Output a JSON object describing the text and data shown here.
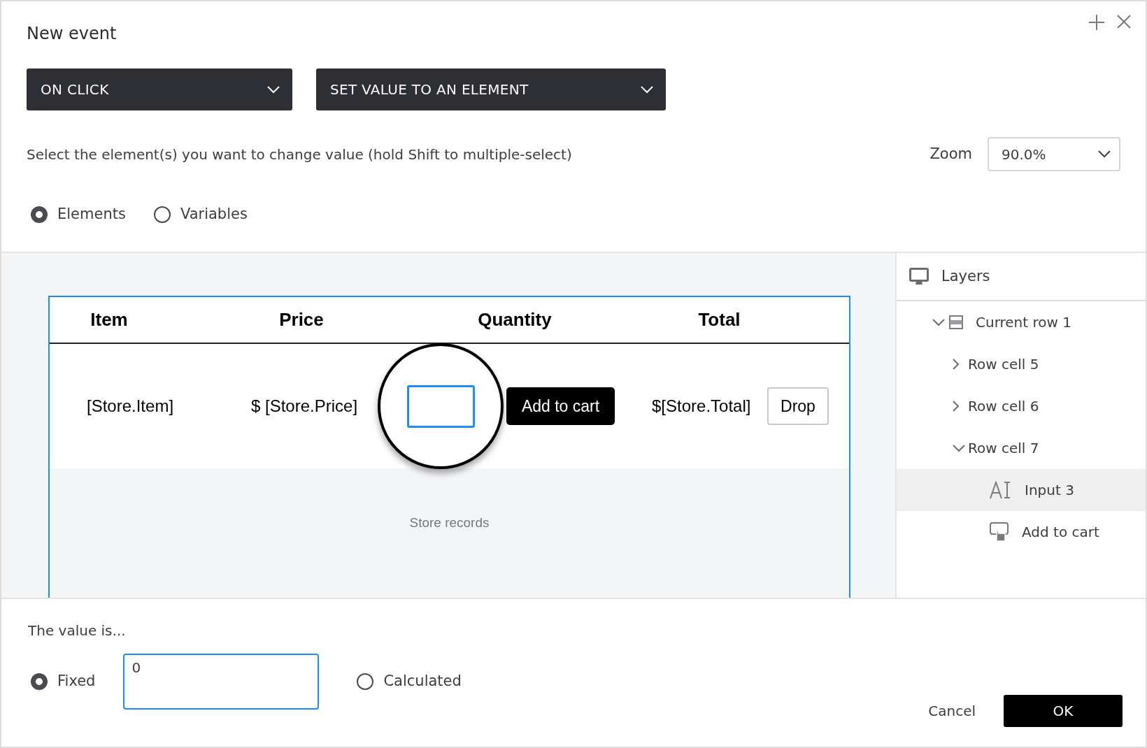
{
  "dialog": {
    "title": "New event"
  },
  "trigger_dropdown": {
    "value": "ON CLICK"
  },
  "action_dropdown": {
    "value": "SET VALUE TO AN ELEMENT"
  },
  "instruction": "Select the element(s) you want to change value (hold Shift to multiple-select)",
  "zoom": {
    "label": "Zoom",
    "value": "90.0%"
  },
  "target_options": [
    {
      "label": "Elements",
      "selected": true
    },
    {
      "label": "Variables",
      "selected": false
    }
  ],
  "canvas": {
    "columns": [
      "Item",
      "Price",
      "Quantity",
      "Total"
    ],
    "row": {
      "item": "[Store.Item]",
      "price": "$ [Store.Price]",
      "add_button": "Add to cart",
      "total": "$[Store.Total]",
      "drop_button": "Drop"
    },
    "footer": "Store records"
  },
  "layers": {
    "title": "Layers",
    "tree": [
      {
        "label": "Current row 1",
        "kind": "row",
        "expanded": true,
        "selected": false,
        "children": [
          {
            "label": "Row cell 5",
            "expanded": false,
            "selected": false
          },
          {
            "label": "Row cell 6",
            "expanded": false,
            "selected": false
          },
          {
            "label": "Row cell 7",
            "expanded": true,
            "selected": false,
            "children": [
              {
                "label": "Input 3",
                "kind": "input",
                "selected": true
              },
              {
                "label": "Add to cart",
                "kind": "button",
                "selected": false
              }
            ]
          }
        ]
      }
    ]
  },
  "value_label": "The value is...",
  "value_options": [
    {
      "label": "Fixed",
      "selected": true
    },
    {
      "label": "Calculated",
      "selected": false
    }
  ],
  "fixed_value": "0",
  "buttons": {
    "cancel": "Cancel",
    "ok": "OK"
  }
}
